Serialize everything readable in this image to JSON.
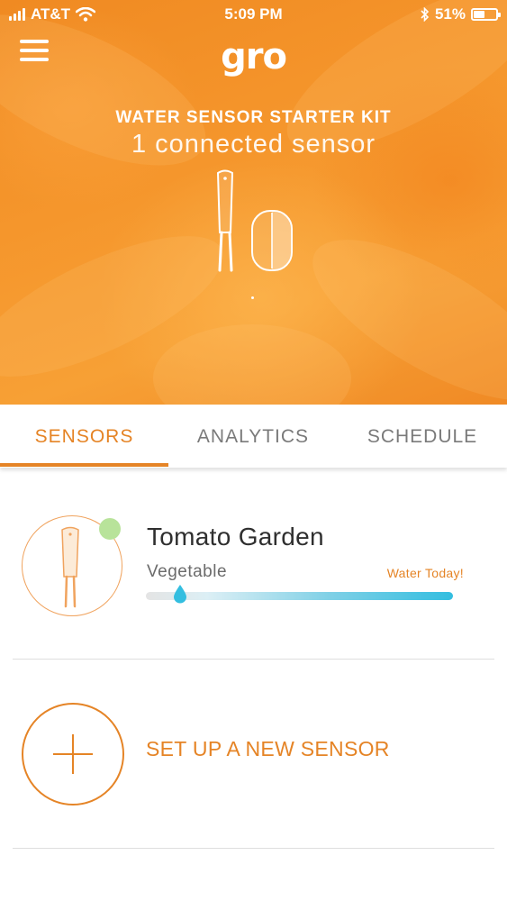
{
  "status_bar": {
    "carrier": "AT&T",
    "time": "5:09 PM",
    "battery_text": "51%",
    "battery_level": 0.51
  },
  "header": {
    "logo": "gro",
    "kit_title": "WATER SENSOR STARTER KIT",
    "connected_text": "1 connected sensor"
  },
  "tabs": [
    {
      "label": "SENSORS",
      "active": true
    },
    {
      "label": "ANALYTICS",
      "active": false
    },
    {
      "label": "SCHEDULE",
      "active": false
    }
  ],
  "sensors": [
    {
      "name": "Tomato Garden",
      "type": "Vegetable",
      "status": "Water Today!",
      "moisture_level": 0.11,
      "online": true
    }
  ],
  "add_sensor": {
    "label": "SET UP A NEW SENSOR"
  },
  "colors": {
    "accent": "#e58426",
    "online": "#b8e39a",
    "moisture": "#33bee0"
  }
}
